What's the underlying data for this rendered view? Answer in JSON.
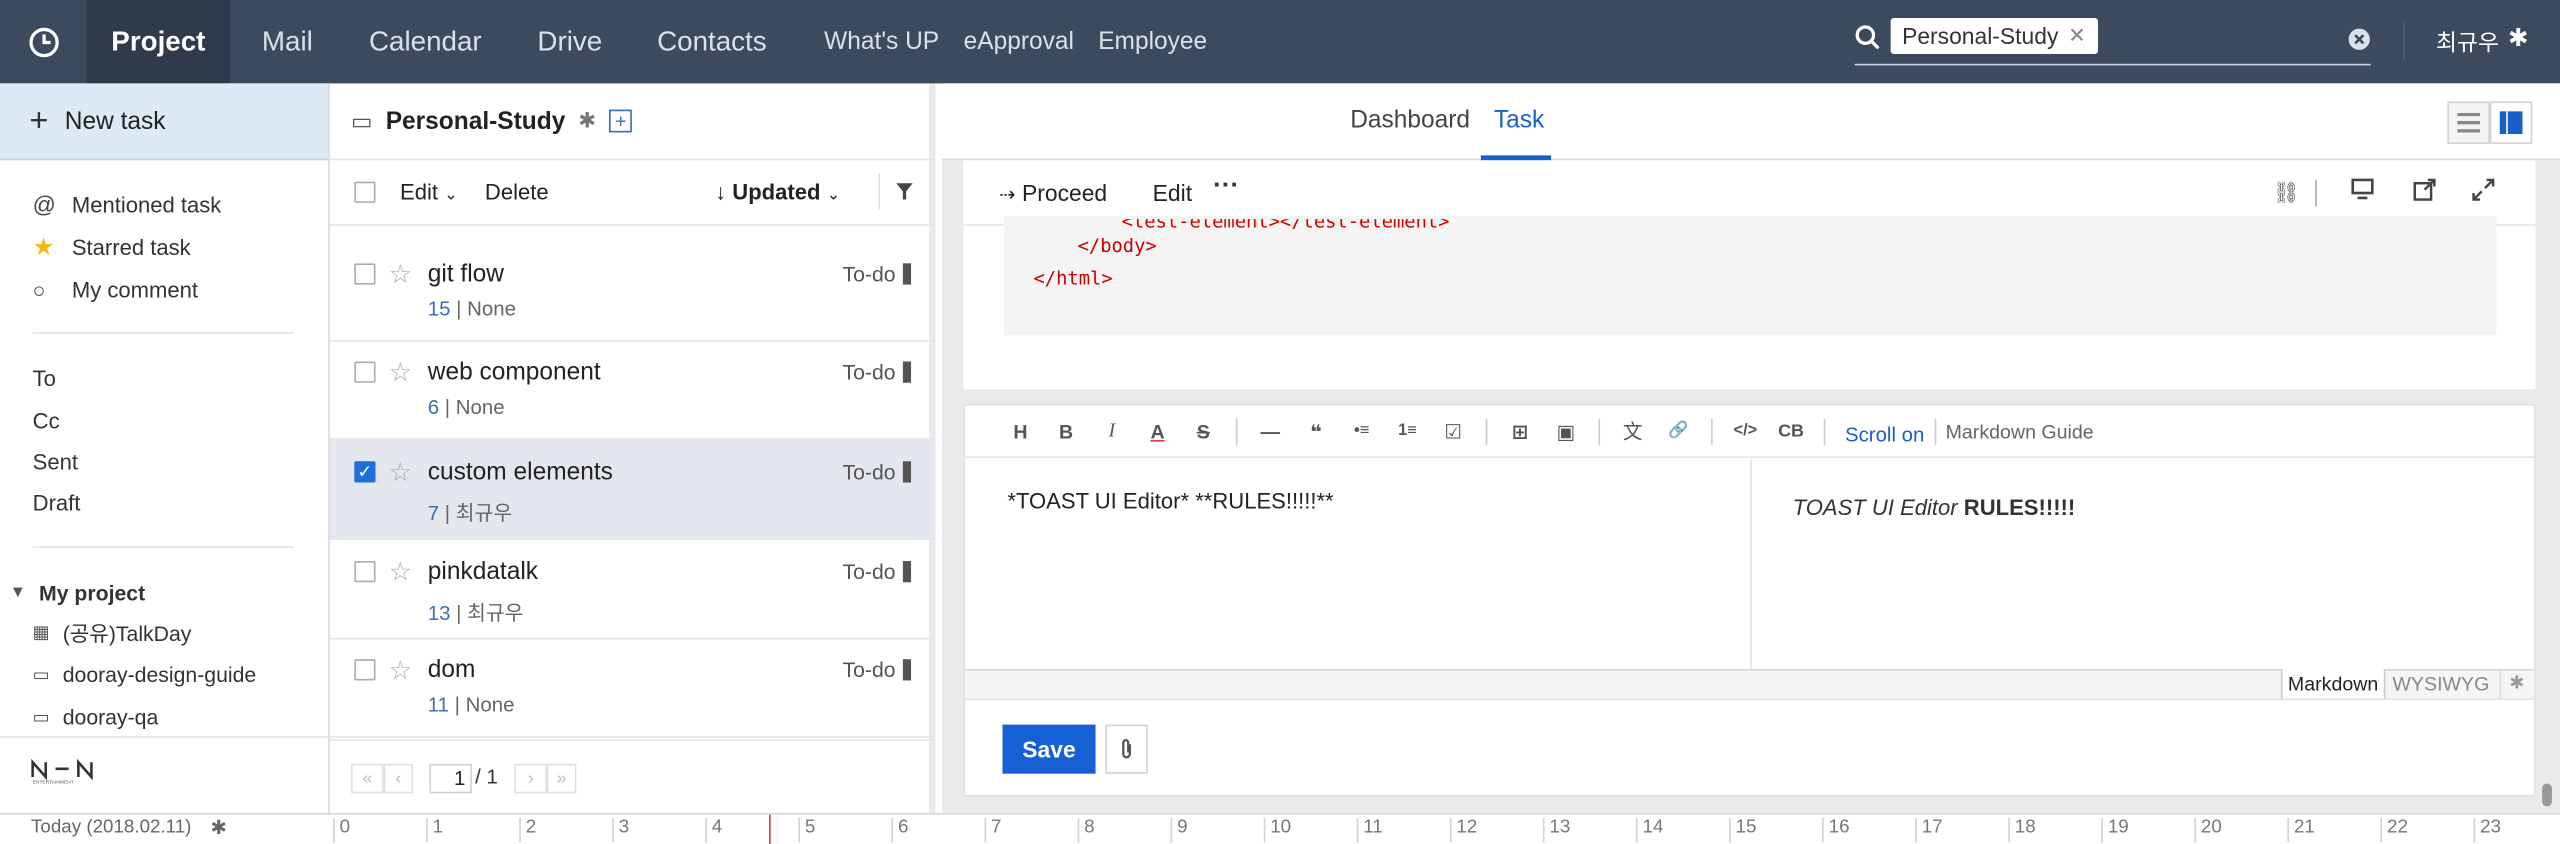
{
  "nav": {
    "items": [
      "Project",
      "Mail",
      "Calendar",
      "Drive",
      "Contacts",
      "What's UP",
      "eApproval",
      "Employee"
    ],
    "active": "Project",
    "search_chip": "Personal-Study",
    "user_name": "최규우"
  },
  "sidebar": {
    "new_task": "New task",
    "filters": [
      "Mentioned task",
      "Starred task",
      "My comment"
    ],
    "mail_items": [
      "To",
      "Cc",
      "Sent",
      "Draft"
    ],
    "my_project_heading": "My project",
    "projects": [
      "(공유)TalkDay",
      "dooray-design-guide",
      "dooray-qa"
    ],
    "brand": "NHN ENTERTAINMENT"
  },
  "board": {
    "title": "Personal-Study",
    "toolbar": {
      "edit": "Edit",
      "delete": "Delete",
      "sort": "Updated"
    },
    "tasks": [
      {
        "title": "git flow",
        "number": "15",
        "assignee": "None",
        "status": "To-do",
        "selected": false
      },
      {
        "title": "web component",
        "number": "6",
        "assignee": "None",
        "status": "To-do",
        "selected": false
      },
      {
        "title": "custom elements",
        "number": "7",
        "assignee": "최규우",
        "status": "To-do",
        "selected": true
      },
      {
        "title": "pinkdatalk",
        "number": "13",
        "assignee": "최규우",
        "status": "To-do",
        "selected": false
      },
      {
        "title": "dom",
        "number": "11",
        "assignee": "None",
        "status": "To-do",
        "selected": false
      }
    ],
    "pager": {
      "current": "1",
      "total": "/ 1"
    }
  },
  "detail": {
    "tabs": [
      "Dashboard",
      "Task"
    ],
    "active_tab": "Task",
    "actions": {
      "proceed": "Proceed",
      "edit": "Edit",
      "more": "···"
    },
    "code_lines": [
      "<test-element></test-element>",
      "</body>",
      "</html>"
    ],
    "editor": {
      "toolbar": [
        "H",
        "B",
        "I",
        "A",
        "S",
        "—",
        "❝",
        "•≡",
        "1≡",
        "☑",
        "⊞",
        "▣",
        "文",
        "🔗",
        "</>",
        "CB"
      ],
      "scroll": "Scroll on",
      "guide": "Markdown Guide",
      "markdown_text": "*TOAST UI Editor* **RULES!!!!!**",
      "preview_italic": "TOAST UI Editor",
      "preview_bold": "RULES!!!!!",
      "mode_markdown": "Markdown",
      "mode_wysiwyg": "WYSIWYG",
      "save": "Save"
    }
  },
  "timeline": {
    "today": "Today (2018.02.11)",
    "hours": [
      "0",
      "1",
      "2",
      "3",
      "4",
      "5",
      "6",
      "7",
      "8",
      "9",
      "10",
      "11",
      "12",
      "13",
      "14",
      "15",
      "16",
      "17",
      "18",
      "19",
      "20",
      "21",
      "22",
      "23"
    ]
  }
}
